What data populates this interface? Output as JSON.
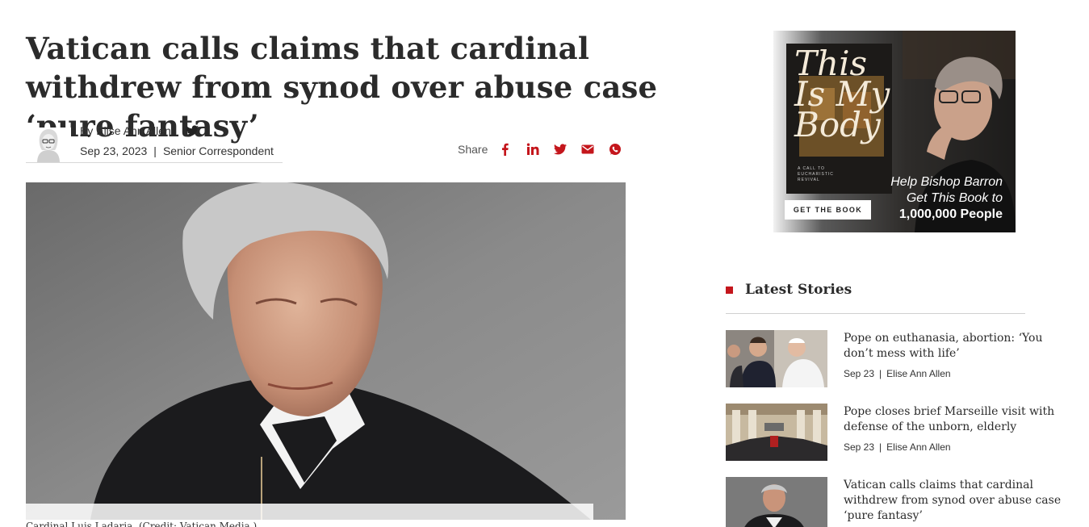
{
  "article": {
    "headline": "Vatican calls claims that cardinal withdrew from synod over abuse case ‘pure fantasy’",
    "byline": "By Elise Ann Allen",
    "date": "Sep 23, 2023",
    "separator": "|",
    "role": "Senior Correspondent",
    "caption": "Cardinal Luis Ladaria. (Credit: Vatican Media.)"
  },
  "share": {
    "label": "Share",
    "icons": [
      "facebook-icon",
      "linkedin-icon",
      "twitter-icon",
      "email-icon",
      "whatsapp-icon"
    ],
    "color": "#c4161c"
  },
  "ad": {
    "book_title_lines": [
      "This",
      "Is My",
      "Body"
    ],
    "book_subtitle": "A CALL TO EUCHARISTIC REVIVAL",
    "button": "GET THE BOOK",
    "tagline_1": "Help Bishop Barron",
    "tagline_2": "Get This Book to",
    "tagline_3": "1,000,000 People"
  },
  "latest": {
    "title": "Latest Stories",
    "accent": "#c4161c",
    "stories": [
      {
        "title": "Pope on euthanasia, abortion: ‘You don’t mess with life’",
        "date": "Sep 23",
        "author": "Elise Ann Allen"
      },
      {
        "title": "Pope closes brief Marseille visit with defense of the unborn, elderly",
        "date": "Sep 23",
        "author": "Elise Ann Allen"
      },
      {
        "title": "Vatican calls claims that cardinal withdrew from synod over abuse case ‘pure fantasy’",
        "date": "",
        "author": ""
      }
    ]
  }
}
